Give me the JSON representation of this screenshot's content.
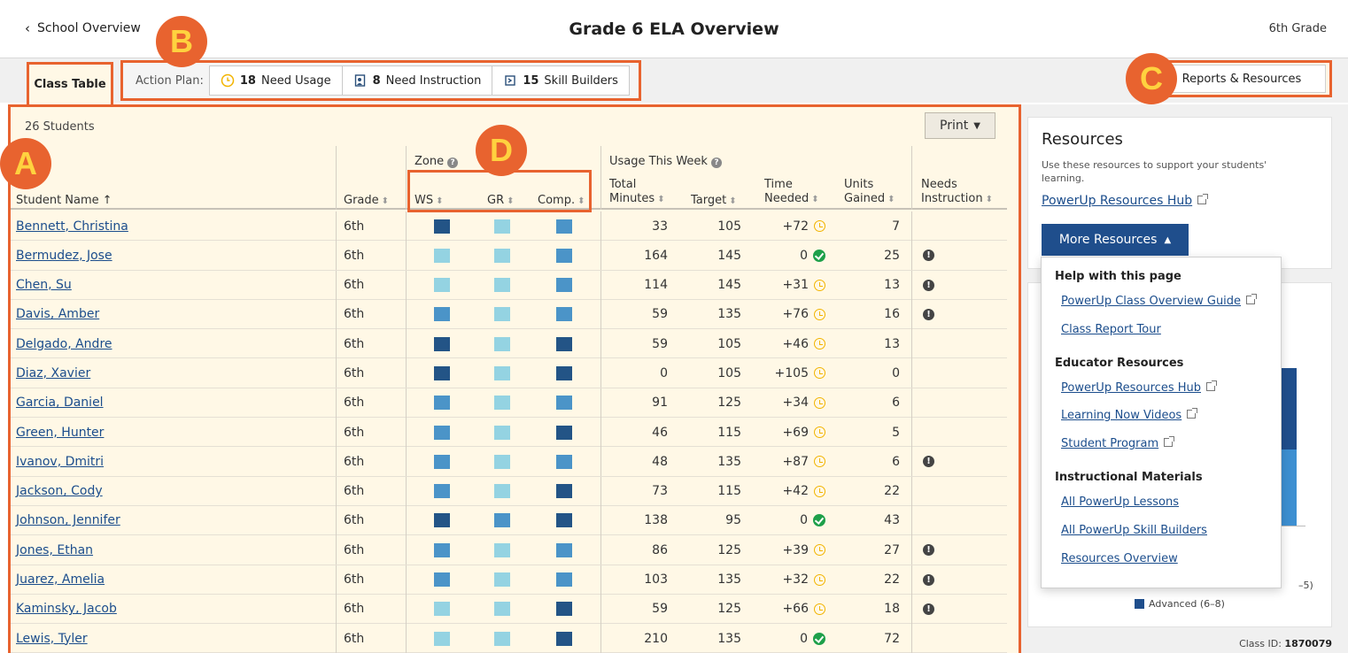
{
  "header": {
    "back_label": "School Overview",
    "title": "Grade 6 ELA Overview",
    "grade": "6th Grade"
  },
  "tabs": {
    "class_table": "Class Table"
  },
  "action_plan": {
    "label": "Action Plan:",
    "items": [
      {
        "count": "18",
        "label": "Need Usage",
        "icon": "clock-icon"
      },
      {
        "count": "8",
        "label": "Need Instruction",
        "icon": "instruction-icon"
      },
      {
        "count": "15",
        "label": "Skill Builders",
        "icon": "skill-builder-icon"
      }
    ]
  },
  "reports_button": "Reports & Resources",
  "badges": {
    "a": "A",
    "b": "B",
    "c": "C",
    "d": "D"
  },
  "table": {
    "student_count": "26 Students",
    "print_label": "Print",
    "columns": {
      "student_name": "Student Name",
      "grade": "Grade",
      "zone": "Zone",
      "ws": "WS",
      "gr": "GR",
      "comp": "Comp.",
      "usage": "Usage This Week",
      "total_1": "Total",
      "total_2": "Minutes",
      "target": "Target",
      "time_1": "Time",
      "time_2": "Needed",
      "units_1": "Units",
      "units_2": "Gained",
      "needs_1": "Needs",
      "needs_2": "Instruction"
    },
    "zone_colors": {
      "dark": "#235486",
      "mid": "#4b94c8",
      "light": "#94d3e2"
    },
    "rows": [
      {
        "name": "Bennett, Christina",
        "grade": "6th",
        "ws": "dark",
        "gr": "light",
        "comp": "mid",
        "total": "33",
        "target": "105",
        "needed": "+72",
        "status": "clock",
        "units": "7",
        "needs": false
      },
      {
        "name": "Bermudez, Jose",
        "grade": "6th",
        "ws": "light",
        "gr": "light",
        "comp": "mid",
        "total": "164",
        "target": "145",
        "needed": "0",
        "status": "check",
        "units": "25",
        "needs": true
      },
      {
        "name": "Chen, Su",
        "grade": "6th",
        "ws": "light",
        "gr": "light",
        "comp": "mid",
        "total": "114",
        "target": "145",
        "needed": "+31",
        "status": "clock",
        "units": "13",
        "needs": true
      },
      {
        "name": "Davis, Amber",
        "grade": "6th",
        "ws": "mid",
        "gr": "light",
        "comp": "mid",
        "total": "59",
        "target": "135",
        "needed": "+76",
        "status": "clock",
        "units": "16",
        "needs": true
      },
      {
        "name": "Delgado, Andre",
        "grade": "6th",
        "ws": "dark",
        "gr": "light",
        "comp": "dark",
        "total": "59",
        "target": "105",
        "needed": "+46",
        "status": "clock",
        "units": "13",
        "needs": false
      },
      {
        "name": "Diaz, Xavier",
        "grade": "6th",
        "ws": "dark",
        "gr": "light",
        "comp": "dark",
        "total": "0",
        "target": "105",
        "needed": "+105",
        "status": "clock",
        "units": "0",
        "needs": false
      },
      {
        "name": "Garcia, Daniel",
        "grade": "6th",
        "ws": "mid",
        "gr": "light",
        "comp": "mid",
        "total": "91",
        "target": "125",
        "needed": "+34",
        "status": "clock",
        "units": "6",
        "needs": false
      },
      {
        "name": "Green, Hunter",
        "grade": "6th",
        "ws": "mid",
        "gr": "light",
        "comp": "dark",
        "total": "46",
        "target": "115",
        "needed": "+69",
        "status": "clock",
        "units": "5",
        "needs": false
      },
      {
        "name": "Ivanov, Dmitri",
        "grade": "6th",
        "ws": "mid",
        "gr": "light",
        "comp": "mid",
        "total": "48",
        "target": "135",
        "needed": "+87",
        "status": "clock",
        "units": "6",
        "needs": true
      },
      {
        "name": "Jackson, Cody",
        "grade": "6th",
        "ws": "mid",
        "gr": "light",
        "comp": "dark",
        "total": "73",
        "target": "115",
        "needed": "+42",
        "status": "clock",
        "units": "22",
        "needs": false
      },
      {
        "name": "Johnson, Jennifer",
        "grade": "6th",
        "ws": "dark",
        "gr": "mid",
        "comp": "dark",
        "total": "138",
        "target": "95",
        "needed": "0",
        "status": "check",
        "units": "43",
        "needs": false
      },
      {
        "name": "Jones, Ethan",
        "grade": "6th",
        "ws": "mid",
        "gr": "light",
        "comp": "mid",
        "total": "86",
        "target": "125",
        "needed": "+39",
        "status": "clock",
        "units": "27",
        "needs": true
      },
      {
        "name": "Juarez, Amelia",
        "grade": "6th",
        "ws": "mid",
        "gr": "light",
        "comp": "mid",
        "total": "103",
        "target": "135",
        "needed": "+32",
        "status": "clock",
        "units": "22",
        "needs": true
      },
      {
        "name": "Kaminsky, Jacob",
        "grade": "6th",
        "ws": "light",
        "gr": "light",
        "comp": "dark",
        "total": "59",
        "target": "125",
        "needed": "+66",
        "status": "clock",
        "units": "18",
        "needs": true
      },
      {
        "name": "Lewis, Tyler",
        "grade": "6th",
        "ws": "light",
        "gr": "light",
        "comp": "dark",
        "total": "210",
        "target": "135",
        "needed": "0",
        "status": "check",
        "units": "72",
        "needs": false
      }
    ]
  },
  "resources": {
    "title": "Resources",
    "description": "Use these resources to support your students' learning.",
    "hub_link": "PowerUp Resources Hub",
    "more_button": "More Resources",
    "menu": {
      "group1": "Help with this page",
      "item1": "PowerUp Class Overview Guide",
      "item2": "Class Report Tour",
      "group2": "Educator Resources",
      "item3": "PowerUp Resources Hub",
      "item4": "Learning Now Videos",
      "item5": "Student Program",
      "group3": "Instructional Materials",
      "item6": "All PowerUp Lessons",
      "item7": "All PowerUp Skill Builders",
      "item8": "Resources Overview"
    },
    "legend_fragment": "–5)",
    "legend_advanced": "Advanced (6–8)",
    "class_id_label": "Class ID:",
    "class_id": "1870079"
  }
}
